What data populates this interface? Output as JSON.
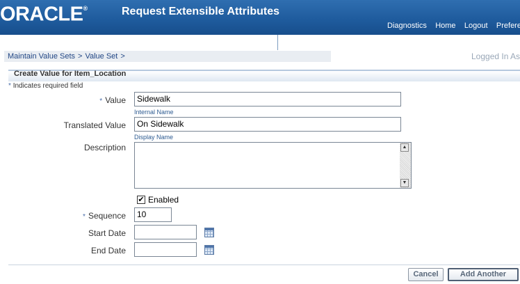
{
  "header": {
    "logo": "ORACLE",
    "logo_mark": "®",
    "title": "Request Extensible Attributes",
    "nav": [
      "Diagnostics",
      "Home",
      "Logout",
      "Preferences"
    ]
  },
  "breadcrumbs": [
    "Maintain Value Sets",
    "Value Set"
  ],
  "breadcrumb_separator": ">",
  "logged_in": "Logged In As",
  "section": {
    "title": "Create Value for Item_Location",
    "required_note": "Indicates required field",
    "required_mark": "*"
  },
  "form": {
    "value_label": "Value",
    "value": "Sidewalk",
    "value_hint": "Internal Name",
    "translated_label": "Translated Value",
    "translated_value": "On Sidewalk",
    "translated_hint": "Display Name",
    "description_label": "Description",
    "description_value": "",
    "enabled_label": "Enabled",
    "enabled_checked": true,
    "sequence_label": "Sequence",
    "sequence_value": "10",
    "start_date_label": "Start Date",
    "start_date_value": "",
    "end_date_label": "End Date",
    "end_date_value": ""
  },
  "buttons": {
    "cancel": "Cancel",
    "add_another": "Add Another"
  },
  "colors": {
    "header_bg": "#1f5c9e",
    "link": "#224785",
    "required_star": "#4a6ea9"
  }
}
